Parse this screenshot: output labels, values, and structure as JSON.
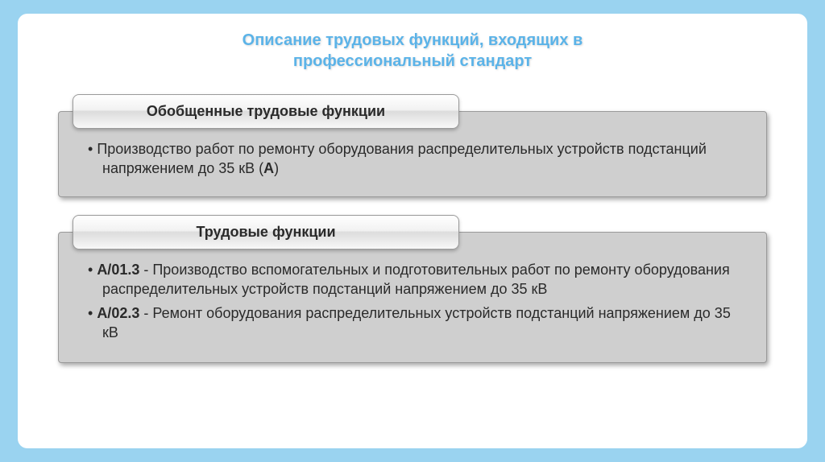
{
  "title_line1": "Описание трудовых функций, входящих в",
  "title_line2": "профессиональный стандарт",
  "block1": {
    "header": "Обобщенные трудовые функции",
    "item1_text": "Производство работ по ремонту оборудования распределительных устройств подстанций напряжением до 35 кВ (",
    "item1_code": "А",
    "item1_close": ")"
  },
  "block2": {
    "header": "Трудовые функции",
    "item1_code": "А/01.3",
    "item1_text": " - Производство вспомогательных и подготовительных работ по ремонту оборудования распределительных устройств подстанций напряжением до 35 кВ",
    "item2_code": "А/02.3",
    "item2_text": " - Ремонт оборудования распределительных устройств подстанций напряжением до 35 кВ"
  }
}
